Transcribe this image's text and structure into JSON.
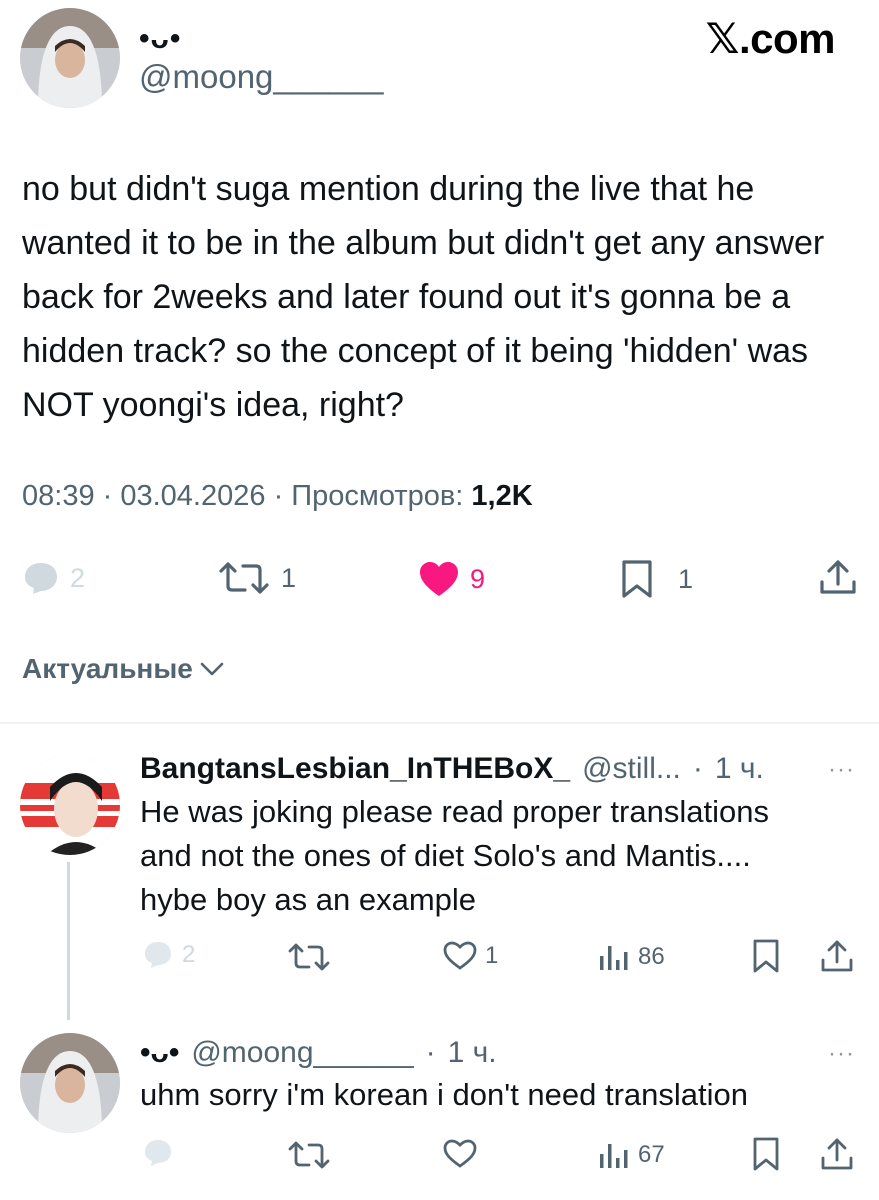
{
  "header": {
    "display_name": "•ᴗ•",
    "handle": "@moong______",
    "site": "𝕏.com"
  },
  "tweet": {
    "text": "no but didn't suga mention during the live that he wanted it to be in the album but didn't get any answer back for 2weeks and later found out it's gonna be a hidden track? so the concept of it being 'hidden' was NOT yoongi's idea, right?",
    "time": "08:39",
    "date": "03.04.2026",
    "views_label": "Просмотров:",
    "views": "1,2K",
    "replies": "2",
    "reposts": "1",
    "likes": "9",
    "bookmarks": "1",
    "like_color": "#f91880"
  },
  "sort": {
    "label": "Актуальные"
  },
  "replies": [
    {
      "name": "BangtansLesbian_InTHEBoX_",
      "handle": "@still...",
      "time": "1 ч.",
      "more": "···",
      "text_lines": [
        "He was joking please read proper translations",
        "and not the ones of diet Solo's and Mantis....",
        "hybe boy as an example"
      ],
      "replies": "2",
      "reposts": "",
      "likes": "1",
      "views": "86"
    },
    {
      "name": "•ᴗ•",
      "handle": "@moong______",
      "time": "1 ч.",
      "more": "···",
      "text_lines": [
        "uhm sorry i'm korean i don't need translation"
      ],
      "replies": "",
      "reposts": "",
      "likes": "",
      "views": "67"
    }
  ]
}
